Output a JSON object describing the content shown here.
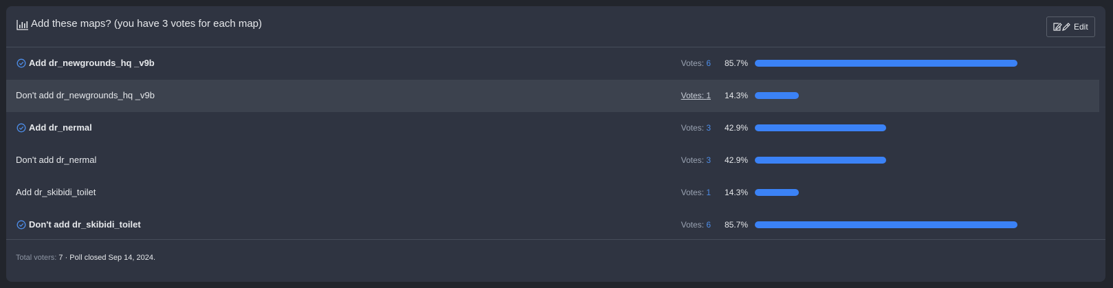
{
  "poll": {
    "title": "Add these maps? (you have 3 votes for each map)",
    "edit_label": "Edit",
    "votes_prefix": "Votes:",
    "accent_color": "#3b82f6",
    "options": [
      {
        "label": "Add dr_newgrounds_hq _v9b",
        "votes": "6",
        "percent": "85.7%",
        "fraction": 0.857,
        "chosen": true,
        "highlighted": false
      },
      {
        "label": "Don't add dr_newgrounds_hq _v9b",
        "votes": "1",
        "percent": "14.3%",
        "fraction": 0.143,
        "chosen": false,
        "highlighted": true
      },
      {
        "label": "Add dr_nermal",
        "votes": "3",
        "percent": "42.9%",
        "fraction": 0.429,
        "chosen": true,
        "highlighted": false
      },
      {
        "label": "Don't add dr_nermal",
        "votes": "3",
        "percent": "42.9%",
        "fraction": 0.429,
        "chosen": false,
        "highlighted": false
      },
      {
        "label": "Add dr_skibidi_toilet",
        "votes": "1",
        "percent": "14.3%",
        "fraction": 0.143,
        "chosen": false,
        "highlighted": false
      },
      {
        "label": "Don't add dr_skibidi_toilet",
        "votes": "6",
        "percent": "85.7%",
        "fraction": 0.857,
        "chosen": true,
        "highlighted": false
      }
    ],
    "footer": {
      "total_label": "Total voters:",
      "total_value": "7",
      "separator": "·",
      "closed_text": "Poll closed Sep 14, 2024."
    }
  }
}
